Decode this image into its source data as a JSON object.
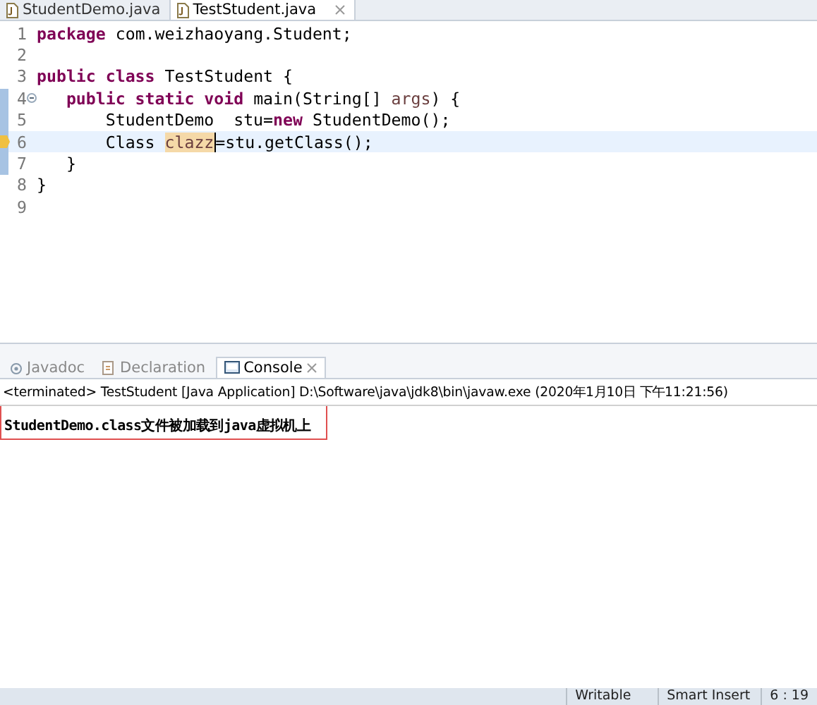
{
  "editor_tabs": [
    {
      "label": "StudentDemo.java",
      "selected": false
    },
    {
      "label": "TestStudent.java",
      "selected": true
    }
  ],
  "code_lines": [
    {
      "number": "1",
      "current": false,
      "in_range": false,
      "collapsible": false,
      "warning": false,
      "tokens": [
        {
          "kind": "keyword",
          "text": "package"
        },
        {
          "kind": "plain",
          "text": " com.weizhaoyang.Student;"
        }
      ]
    },
    {
      "number": "2",
      "current": false,
      "in_range": false,
      "collapsible": false,
      "warning": false
    },
    {
      "number": "3",
      "current": false,
      "in_range": false,
      "collapsible": false,
      "warning": false,
      "tokens": [
        {
          "kind": "keyword",
          "text": "public class"
        },
        {
          "kind": "plain",
          "text": " TestStudent {"
        }
      ]
    },
    {
      "number": "4",
      "current": false,
      "in_range": true,
      "collapsible": true,
      "warning": false,
      "tokens": [
        {
          "kind": "keyword",
          "text": "   public static void"
        },
        {
          "kind": "plain",
          "text": " main(String[] "
        },
        {
          "kind": "param",
          "text": "args"
        },
        {
          "kind": "plain",
          "text": ") {"
        }
      ]
    },
    {
      "number": "5",
      "current": false,
      "in_range": true,
      "collapsible": false,
      "warning": false,
      "tokens": [
        {
          "kind": "plain",
          "text": "       StudentDemo  stu="
        },
        {
          "kind": "keyword",
          "text": "new"
        },
        {
          "kind": "plain",
          "text": " StudentDemo();"
        }
      ]
    },
    {
      "number": "6",
      "current": true,
      "in_range": true,
      "collapsible": false,
      "warning": true,
      "tokens": [
        {
          "kind": "plain",
          "text": "       Class "
        },
        {
          "kind": "occurrence",
          "text": "clazz"
        },
        {
          "kind": "plain",
          "text": "=stu.getClass();"
        }
      ]
    },
    {
      "number": "7",
      "current": false,
      "in_range": true,
      "collapsible": false,
      "warning": false,
      "tokens": [
        {
          "kind": "plain",
          "text": "   }"
        }
      ]
    },
    {
      "number": "8",
      "current": false,
      "in_range": false,
      "collapsible": false,
      "warning": false,
      "tokens": [
        {
          "kind": "plain",
          "text": "}"
        }
      ]
    },
    {
      "number": "9",
      "current": false,
      "in_range": false,
      "collapsible": false,
      "warning": false
    }
  ],
  "panel_tabs": [
    {
      "label": "Javadoc",
      "selected": false
    },
    {
      "label": "Declaration",
      "selected": false
    },
    {
      "label": "Console",
      "selected": true
    }
  ],
  "console": {
    "header": "<terminated> TestStudent [Java Application] D:\\Software\\java\\jdk8\\bin\\javaw.exe (2020年1月10日 下午11:21:56)",
    "output": "StudentDemo.class文件被加载到java虚拟机上"
  },
  "status_bar": [
    "Writable",
    "Smart Insert",
    "6 : 19"
  ]
}
